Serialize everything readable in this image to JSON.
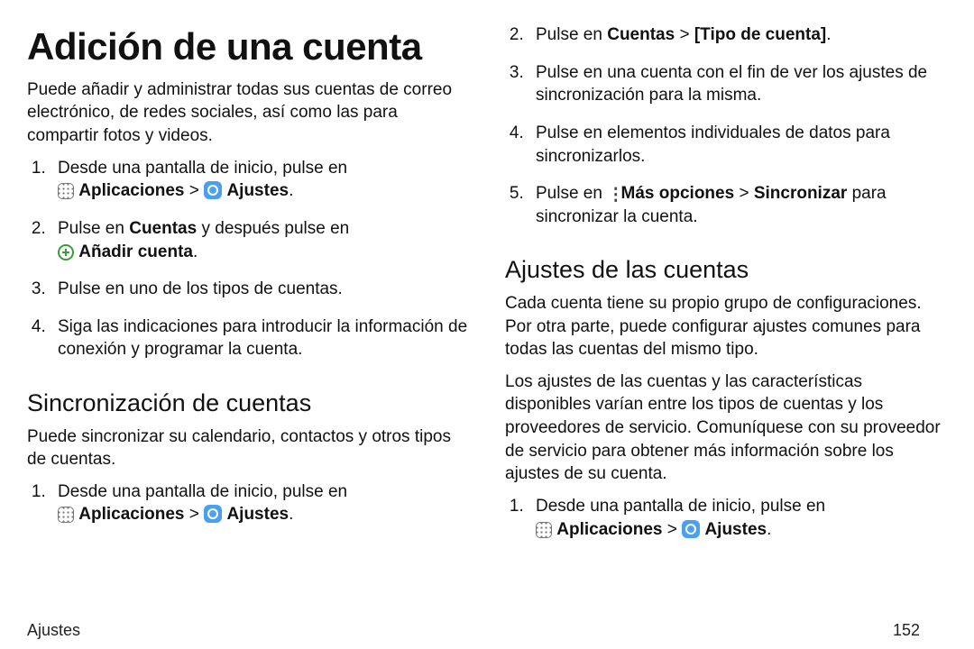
{
  "title": "Adición de una cuenta",
  "intro": "Puede añadir y administrar todas sus cuentas de correo electrónico, de redes sociales, así como las para compartir fotos y videos.",
  "labels": {
    "aplicaciones": "Aplicaciones",
    "ajustes": "Ajustes",
    "anadir_cuenta": "Añadir cuenta",
    "cuentas": "Cuentas",
    "tipo_de_cuenta": "[Tipo de cuenta]",
    "mas_opciones": "Más opciones",
    "sincronizar": "Sincronizar"
  },
  "steps_main": {
    "s1_a": "Desde una pantalla de inicio, pulse en ",
    "s1_sep": " > ",
    "s2_a": "Pulse en ",
    "s2_b": " y después pulse en ",
    "s3": "Pulse en uno de los tipos de cuentas.",
    "s4": "Siga las indicaciones para introducir la información de conexión y programar la cuenta."
  },
  "section_sync": {
    "heading": "Sincronización de cuentas",
    "intro": "Puede sincronizar su calendario, contactos y otros tipos de cuentas.",
    "s1_a": "Desde una pantalla de inicio, pulse en ",
    "s1_sep": " > ",
    "s2_a": "Pulse en ",
    "s2_sep": " > ",
    "s3": "Pulse en una cuenta con el fin de ver los ajustes de sincronización para la misma.",
    "s4": "Pulse en elementos individuales de datos para sincronizarlos.",
    "s5_a": "Pulse en ",
    "s5_sep": " > ",
    "s5_b": " para sincronizar la cuenta."
  },
  "section_settings": {
    "heading": "Ajustes de las cuentas",
    "p1": "Cada cuenta tiene su propio grupo de configuraciones. Por otra parte, puede configurar ajustes comunes para todas las cuentas del mismo tipo.",
    "p2": "Los ajustes de las cuentas y las características disponibles varían entre los tipos de cuentas y los proveedores de servicio. Comuníquese con su proveedor de servicio para obtener más información sobre los ajustes de su cuenta.",
    "s1_a": "Desde una pantalla de inicio, pulse en ",
    "s1_sep": " > "
  },
  "footer": {
    "section": "Ajustes",
    "page": "152"
  },
  "punct": {
    "period": "."
  }
}
